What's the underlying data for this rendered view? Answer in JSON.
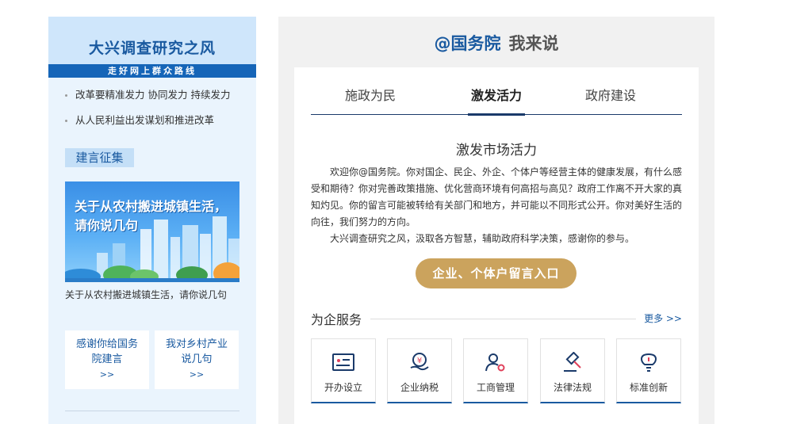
{
  "left": {
    "title": "大兴调查研究之风",
    "subtitle": "走好网上群众路线",
    "bullets": [
      "改革要精准发力 协同发力 持续发力",
      "从人民利益出发谋划和推进改革"
    ],
    "tag": "建言征集",
    "banner_text_line1": "关于从农村搬进城镇生活，",
    "banner_text_line2": "请你说几句",
    "banner_caption": "关于从农村搬进城镇生活，请你说几句",
    "card1_line1": "感谢你给国务",
    "card1_line2": "院建言",
    "card2_line1": "我对乡村产业",
    "card2_line2": "说几句",
    "card_arrow": ">>"
  },
  "right": {
    "title_at": "@国务院",
    "title_say": "我来说",
    "tabs": [
      "施政为民",
      "激发活力",
      "政府建设"
    ],
    "active_tab": 1,
    "section_title": "激发市场活力",
    "para1": "欢迎你@国务院。你对国企、民企、外企、个体户等经营主体的健康发展，有什么感受和期待？你对完善政策措施、优化营商环境有何高招与高见？政府工作离不开大家的真知灼见。你的留言可能被转给有关部门和地方，并可能以不同形式公开。你对美好生活的向往，我们努力的方向。",
    "para2": "大兴调查研究之风，汲取各方智慧，辅助政府科学决策，感谢你的参与。",
    "cta": "企业、个体户留言入口",
    "services_title": "为企服务",
    "services_more": "更多 >>",
    "services": [
      {
        "label": "开办设立",
        "icon": "id-card-icon"
      },
      {
        "label": "企业纳税",
        "icon": "tax-coin-icon"
      },
      {
        "label": "工商管理",
        "icon": "person-gear-icon"
      },
      {
        "label": "法律法规",
        "icon": "gavel-icon"
      },
      {
        "label": "标准创新",
        "icon": "lightbulb-icon"
      }
    ]
  },
  "colors": {
    "accent": "#1a5aa0",
    "cta": "#cba35d",
    "left_bg": "#eaf4fd",
    "right_bg": "#f1f1f1"
  }
}
